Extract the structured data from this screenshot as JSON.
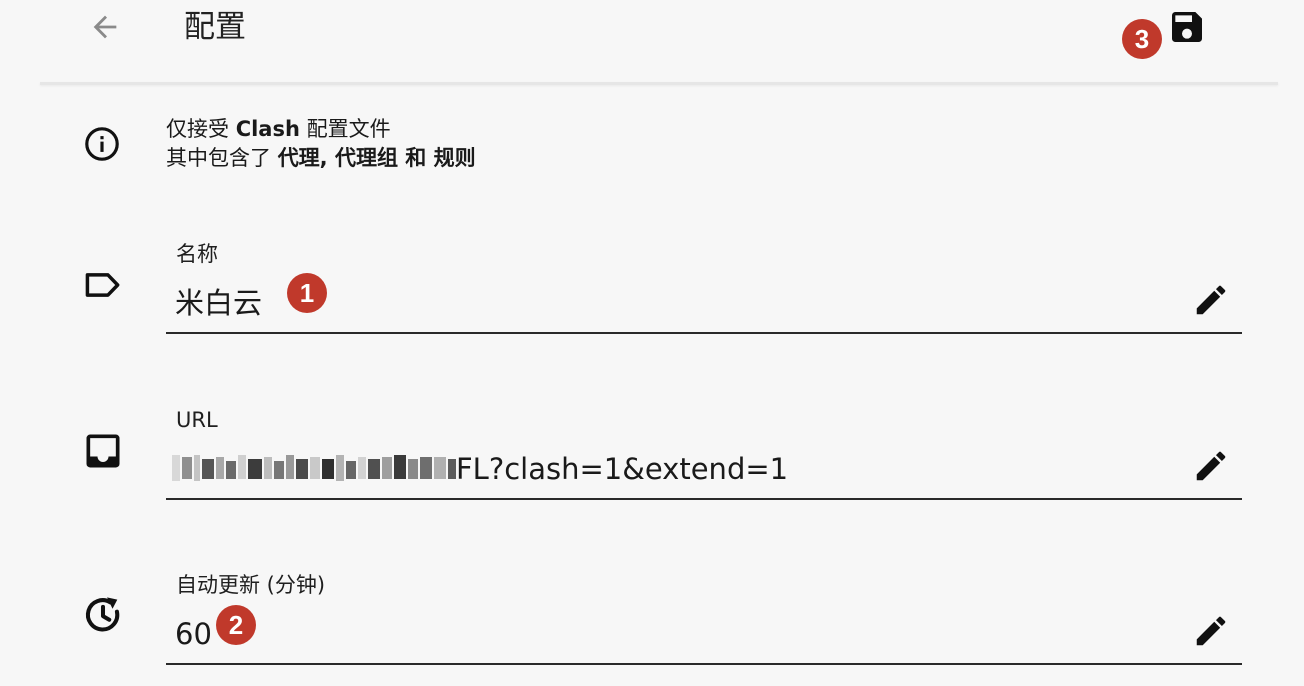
{
  "header": {
    "title": "配置",
    "back_icon": "arrow-left-icon",
    "save_icon": "save-floppy-icon",
    "save_badge": "3"
  },
  "info": {
    "icon": "info-circle-icon",
    "line1_pre": "仅接受 ",
    "line1_bold": "Clash",
    "line1_post": " 配置文件",
    "line2_pre": "其中包含了 ",
    "line2_bold": "代理, 代理组 和 规则"
  },
  "fields": {
    "name": {
      "icon": "label-tag-icon",
      "label": "名称",
      "value": "米白云",
      "badge": "1",
      "edit_icon": "pencil-edit-icon"
    },
    "url": {
      "icon": "inbox-icon",
      "label": "URL",
      "value_visible": "FL?clash=1&extend=1",
      "edit_icon": "pencil-edit-icon"
    },
    "interval": {
      "icon": "clock-refresh-icon",
      "label": "自动更新 (分钟)",
      "value": "60",
      "badge": "2",
      "edit_icon": "pencil-edit-icon"
    }
  },
  "colors": {
    "badge": "#c0392b",
    "background": "#f7f7f7",
    "text": "#1a1a1a"
  }
}
